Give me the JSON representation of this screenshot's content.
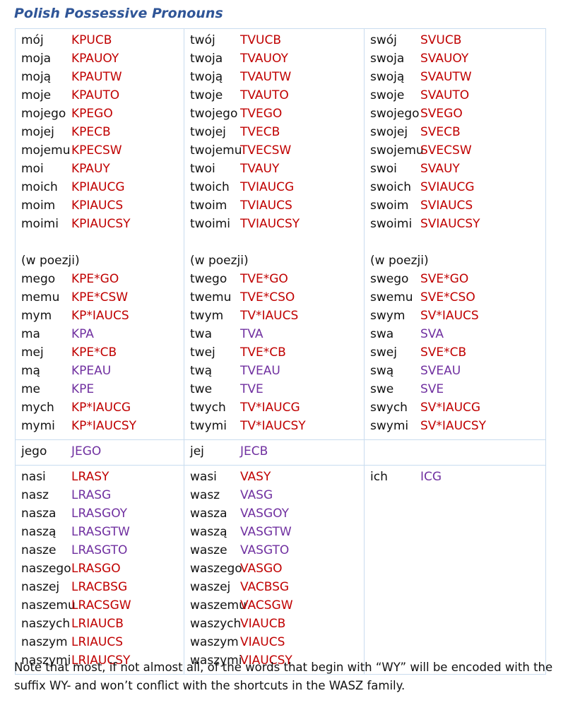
{
  "title": "Polish Possessive Pronouns",
  "colors": {
    "title": "#2f5597",
    "red": "#c00000",
    "purple": "#7030a0",
    "border": "#c9dcef"
  },
  "columns": [
    {
      "main": [
        {
          "word": "mój",
          "code": "KPUCB",
          "color": "red"
        },
        {
          "word": "moja",
          "code": "KPAUOY",
          "color": "red"
        },
        {
          "word": "moją",
          "code": "KPAUTW",
          "color": "red"
        },
        {
          "word": "moje",
          "code": "KPAUTO",
          "color": "red"
        },
        {
          "word": "mojego",
          "code": "KPEGO",
          "color": "red"
        },
        {
          "word": "mojej",
          "code": "KPECB",
          "color": "red"
        },
        {
          "word": "mojemu",
          "code": "KPECSW",
          "color": "red"
        },
        {
          "word": "moi",
          "code": "KPAUY",
          "color": "red"
        },
        {
          "word": "moich",
          "code": "KPIAUCG",
          "color": "red"
        },
        {
          "word": "moim",
          "code": "KPIAUCS",
          "color": "red"
        },
        {
          "word": "moimi",
          "code": "KPIAUCSY",
          "color": "red"
        }
      ],
      "poezji_label": "(w poezji)",
      "poezji": [
        {
          "word": "mego",
          "code": "KPE*GO",
          "color": "red"
        },
        {
          "word": "memu",
          "code": "KPE*CSW",
          "color": "red"
        },
        {
          "word": "mym",
          "code": "KP*IAUCS",
          "color": "red"
        },
        {
          "word": "ma",
          "code": "KPA",
          "color": "purple"
        },
        {
          "word": "mej",
          "code": "KPE*CB",
          "color": "red"
        },
        {
          "word": "mą",
          "code": "KPEAU",
          "color": "purple"
        },
        {
          "word": "me",
          "code": "KPE",
          "color": "purple"
        },
        {
          "word": "mych",
          "code": "KP*IAUCG",
          "color": "red"
        },
        {
          "word": "mymi",
          "code": "KP*IAUCSY",
          "color": "red"
        }
      ]
    },
    {
      "main": [
        {
          "word": "twój",
          "code": "TVUCB",
          "color": "red"
        },
        {
          "word": "twoja",
          "code": "TVAUOY",
          "color": "red"
        },
        {
          "word": "twoją",
          "code": "TVAUTW",
          "color": "red"
        },
        {
          "word": "twoje",
          "code": "TVAUTO",
          "color": "red"
        },
        {
          "word": "twojego",
          "code": "TVEGO",
          "color": "red"
        },
        {
          "word": "twojej",
          "code": "TVECB",
          "color": "red"
        },
        {
          "word": "twojemu",
          "code": "TVECSW",
          "color": "red"
        },
        {
          "word": "twoi",
          "code": "TVAUY",
          "color": "red"
        },
        {
          "word": "twoich",
          "code": "TVIAUCG",
          "color": "red"
        },
        {
          "word": "twoim",
          "code": "TVIAUCS",
          "color": "red"
        },
        {
          "word": "twoimi",
          "code": "TVIAUCSY",
          "color": "red"
        }
      ],
      "poezji_label": "(w poezji)",
      "poezji": [
        {
          "word": "twego",
          "code": "TVE*GO",
          "color": "red"
        },
        {
          "word": "twemu",
          "code": "TVE*CSO",
          "color": "red"
        },
        {
          "word": "twym",
          "code": "TV*IAUCS",
          "color": "red"
        },
        {
          "word": "twa",
          "code": "TVA",
          "color": "purple"
        },
        {
          "word": "twej",
          "code": "TVE*CB",
          "color": "red"
        },
        {
          "word": "twą",
          "code": "TVEAU",
          "color": "purple"
        },
        {
          "word": "twe",
          "code": "TVE",
          "color": "purple"
        },
        {
          "word": "twych",
          "code": "TV*IAUCG",
          "color": "red"
        },
        {
          "word": "twymi",
          "code": "TV*IAUCSY",
          "color": "red"
        }
      ]
    },
    {
      "main": [
        {
          "word": "swój",
          "code": "SVUCB",
          "color": "red"
        },
        {
          "word": "swoja",
          "code": "SVAUOY",
          "color": "red"
        },
        {
          "word": "swoją",
          "code": "SVAUTW",
          "color": "red"
        },
        {
          "word": "swoje",
          "code": "SVAUTO",
          "color": "red"
        },
        {
          "word": "swojego",
          "code": "SVEGO",
          "color": "red"
        },
        {
          "word": "swojej",
          "code": "SVECB",
          "color": "red"
        },
        {
          "word": "swojemu",
          "code": "SVECSW",
          "color": "red"
        },
        {
          "word": "swoi",
          "code": "SVAUY",
          "color": "red"
        },
        {
          "word": "swoich",
          "code": "SVIAUCG",
          "color": "red"
        },
        {
          "word": "swoim",
          "code": "SVIAUCS",
          "color": "red"
        },
        {
          "word": "swoimi",
          "code": "SVIAUCSY",
          "color": "red"
        }
      ],
      "poezji_label": "(w poezji)",
      "poezji": [
        {
          "word": "swego",
          "code": "SVE*GO",
          "color": "red"
        },
        {
          "word": "swemu",
          "code": "SVE*CSO",
          "color": "red"
        },
        {
          "word": "swym",
          "code": "SV*IAUCS",
          "color": "red"
        },
        {
          "word": "swa",
          "code": "SVA",
          "color": "purple"
        },
        {
          "word": "swej",
          "code": "SVE*CB",
          "color": "red"
        },
        {
          "word": "swą",
          "code": "SVEAU",
          "color": "purple"
        },
        {
          "word": "swe",
          "code": "SVE",
          "color": "purple"
        },
        {
          "word": "swych",
          "code": "SV*IAUCG",
          "color": "red"
        },
        {
          "word": "swymi",
          "code": "SV*IAUCSY",
          "color": "red"
        }
      ]
    }
  ],
  "row2": [
    {
      "word": "jego",
      "code": "JEGO",
      "color": "purple"
    },
    {
      "word": "jej",
      "code": "JECB",
      "color": "purple"
    }
  ],
  "row3": [
    [
      {
        "word": "nasi",
        "code": "LRASY",
        "color": "red"
      },
      {
        "word": "nasz",
        "code": "LRASG",
        "color": "purple"
      },
      {
        "word": "nasza",
        "code": "LRASGOY",
        "color": "purple"
      },
      {
        "word": "naszą",
        "code": "LRASGTW",
        "color": "purple"
      },
      {
        "word": "nasze",
        "code": "LRASGTO",
        "color": "purple"
      },
      {
        "word": "naszego",
        "code": "LRASGO",
        "color": "red"
      },
      {
        "word": "naszej",
        "code": "LRACBSG",
        "color": "red"
      },
      {
        "word": "naszemu",
        "code": "LRACSGW",
        "color": "red"
      },
      {
        "word": "naszych",
        "code": "LRIAUCB",
        "color": "red"
      },
      {
        "word": "naszym",
        "code": "LRIAUCS",
        "color": "red"
      },
      {
        "word": "naszymi",
        "code": "LRIAUCSY",
        "color": "red"
      }
    ],
    [
      {
        "word": "wasi",
        "code": "VASY",
        "color": "red"
      },
      {
        "word": "wasz",
        "code": "VASG",
        "color": "purple"
      },
      {
        "word": "wasza",
        "code": "VASGOY",
        "color": "purple"
      },
      {
        "word": "waszą",
        "code": "VASGTW",
        "color": "purple"
      },
      {
        "word": "wasze",
        "code": "VASGTO",
        "color": "purple"
      },
      {
        "word": "waszego",
        "code": "VASGO",
        "color": "red"
      },
      {
        "word": "waszej",
        "code": "VACBSG",
        "color": "red"
      },
      {
        "word": "waszemu",
        "code": "VACSGW",
        "color": "red"
      },
      {
        "word": "waszych",
        "code": "VIAUCB",
        "color": "red"
      },
      {
        "word": "waszym",
        "code": "VIAUCS",
        "color": "red"
      },
      {
        "word": "waszymi",
        "code": "VIAUCSY",
        "color": "red"
      }
    ],
    [
      {
        "word": "ich",
        "code": "ICG",
        "color": "purple"
      }
    ]
  ],
  "note": "Note that most, if not almost all, of the words that begin with “WY” will be encoded with the suffix WY- and won’t conflict with the shortcuts in the WASZ family."
}
